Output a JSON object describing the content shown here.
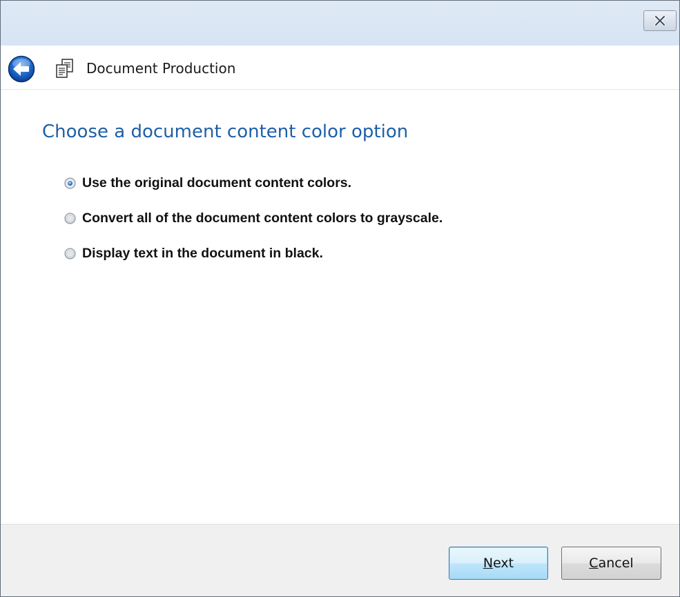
{
  "window": {
    "title": "Document Production"
  },
  "titlebar": {
    "close_icon": "close-x-icon"
  },
  "header": {
    "back_icon": "back-arrow-icon",
    "app_icon": "document-production-icon",
    "title": "Document Production"
  },
  "main": {
    "heading": "Choose a document content color option",
    "options": [
      {
        "label": "Use the original document content colors.",
        "selected": true
      },
      {
        "label": "Convert all of the document content colors to grayscale.",
        "selected": false
      },
      {
        "label": "Display text in the document in black.",
        "selected": false
      }
    ]
  },
  "footer": {
    "next_mnemonic": "N",
    "next_rest": "ext",
    "cancel_mnemonic": "C",
    "cancel_rest": "ancel"
  },
  "colors": {
    "heading": "#1e5fa8",
    "accent": "#3c7fb1"
  }
}
